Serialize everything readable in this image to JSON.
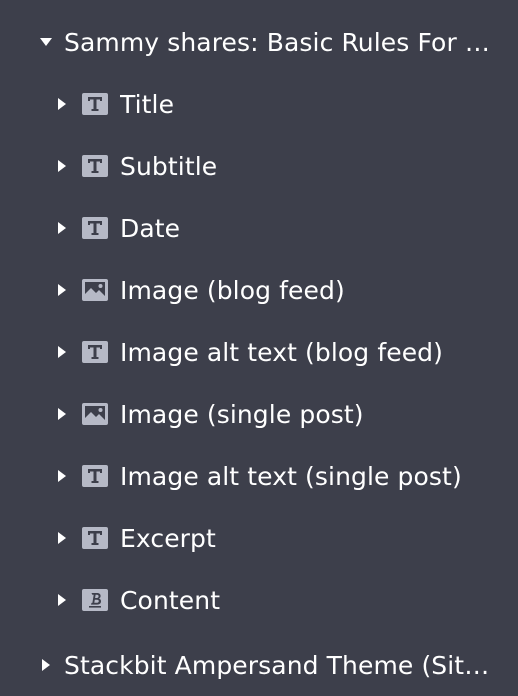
{
  "tree": {
    "root": {
      "label": "Sammy shares: Basic Rules For Bloggers",
      "expanded": true
    },
    "children": [
      {
        "label": "Title",
        "icon": "text-field-icon"
      },
      {
        "label": "Subtitle",
        "icon": "text-field-icon"
      },
      {
        "label": "Date",
        "icon": "text-field-icon"
      },
      {
        "label": "Image (blog feed)",
        "icon": "image-field-icon"
      },
      {
        "label": "Image alt text (blog feed)",
        "icon": "text-field-icon"
      },
      {
        "label": "Image (single post)",
        "icon": "image-field-icon"
      },
      {
        "label": "Image alt text (single post)",
        "icon": "text-field-icon"
      },
      {
        "label": "Excerpt",
        "icon": "text-field-icon"
      },
      {
        "label": "Content",
        "icon": "markdown-field-icon"
      }
    ],
    "sibling": {
      "label": "Stackbit Ampersand Theme (Site Settings)",
      "expanded": false
    }
  },
  "colors": {
    "background": "#3d3f4b",
    "text": "#ffffff",
    "icon_fill": "#b6b9c6",
    "icon_glyph": "#3d3f4b"
  }
}
